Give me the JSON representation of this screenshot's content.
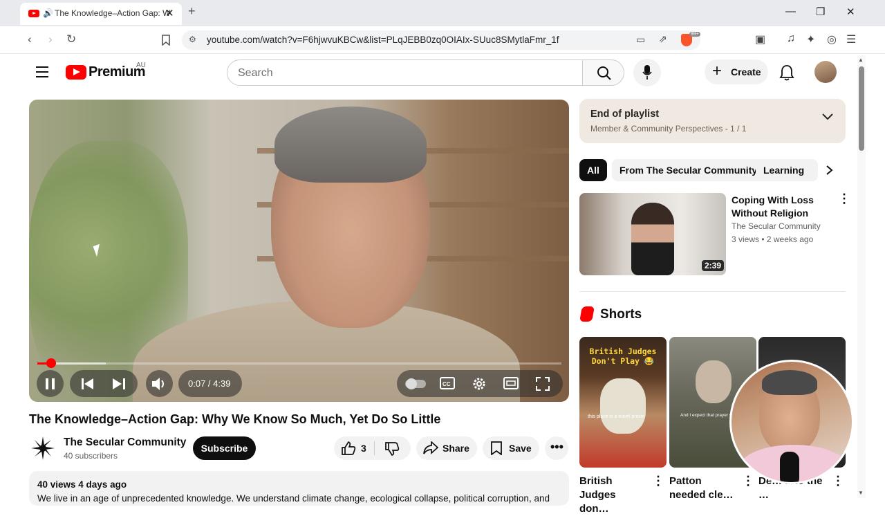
{
  "browser": {
    "tab_title": "The Knowledge–Action Gap: W",
    "url": "youtube.com/watch?v=F6hjwvuKBCw&list=PLqJEBB0zq0OIAIx-SUuc8SMytlaFmr_1f",
    "extension_badge": "99+"
  },
  "header": {
    "logo_text": "Premium",
    "region": "AU",
    "search_placeholder": "Search",
    "create_label": "Create"
  },
  "player": {
    "time": "0:07 / 4:39",
    "progress_fraction": 0.025,
    "buffered_fraction": 0.13
  },
  "video": {
    "title": "The Knowledge–Action Gap: Why We Know So Much, Yet Do So Little",
    "channel_name": "The Secular Community",
    "subscribers": "40 subscribers",
    "subscribe_label": "Subscribe",
    "likes": "3",
    "share_label": "Share",
    "save_label": "Save",
    "meta": "40 views  4 days ago",
    "description": "We live in an age of unprecedented knowledge. We understand climate change, ecological collapse, political corruption, and"
  },
  "playlist": {
    "status": "End of playlist",
    "detail": "Member & Community Perspectives - 1 / 1"
  },
  "chips": [
    "All",
    "From The Secular Community",
    "Learning"
  ],
  "recommendation": {
    "title": "Coping With Loss Without Religion",
    "channel": "The Secular Community",
    "stats": "3 views • 2 weeks ago",
    "duration": "2:39"
  },
  "shorts": {
    "heading": "Shorts",
    "items": [
      {
        "title": "British Judges don…",
        "overlay": "British Judges Don't Play 😂",
        "caption": "this place is a travel prison"
      },
      {
        "title": "Patton needed cle…",
        "overlay": "",
        "caption": "And I expect that prayer with"
      },
      {
        "title": "De… into the …",
        "overlay": "",
        "caption": ""
      }
    ]
  },
  "colors": {
    "brand_red": "#ff0000",
    "playlist_bg": "#efe9e1"
  }
}
